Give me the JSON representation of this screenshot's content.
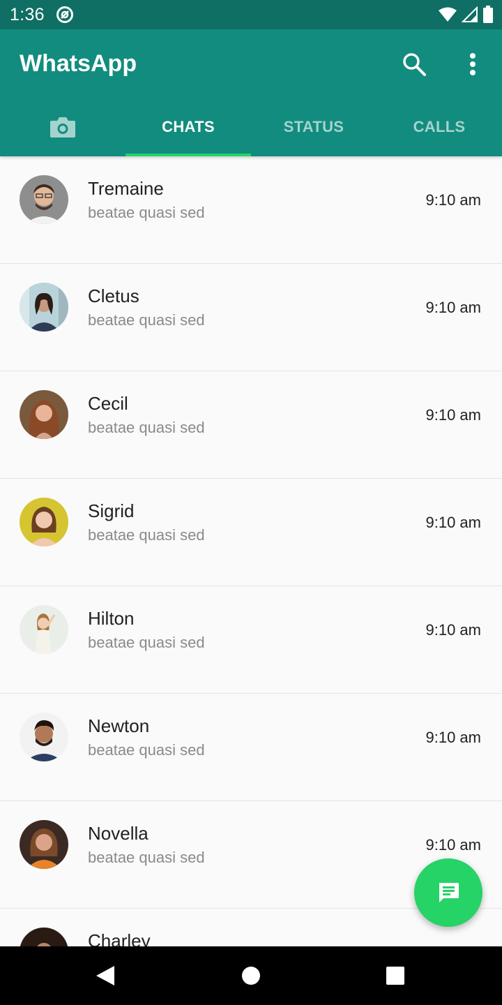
{
  "status_bar": {
    "time": "1:36"
  },
  "app": {
    "title": "WhatsApp"
  },
  "tabs": [
    {
      "label": "CHATS",
      "selected": true
    },
    {
      "label": "STATUS",
      "selected": false
    },
    {
      "label": "CALLS",
      "selected": false
    }
  ],
  "chats": [
    {
      "name": "Tremaine",
      "message": "beatae quasi sed",
      "time": "9:10 am"
    },
    {
      "name": "Cletus",
      "message": "beatae quasi sed",
      "time": "9:10 am"
    },
    {
      "name": "Cecil",
      "message": "beatae quasi sed",
      "time": "9:10 am"
    },
    {
      "name": "Sigrid",
      "message": "beatae quasi sed",
      "time": "9:10 am"
    },
    {
      "name": "Hilton",
      "message": "beatae quasi sed",
      "time": "9:10 am"
    },
    {
      "name": "Newton",
      "message": "beatae quasi sed",
      "time": "9:10 am"
    },
    {
      "name": "Novella",
      "message": "beatae quasi sed",
      "time": "9:10 am"
    },
    {
      "name": "Charley",
      "message": "",
      "time": ""
    }
  ],
  "colors": {
    "status_bar": "#0f6f64",
    "app_bar": "#128c7e",
    "accent": "#25d366"
  },
  "icons": {
    "status_bar": [
      "at-sign-icon",
      "wifi-icon",
      "signal-icon",
      "battery-icon"
    ],
    "app_bar": [
      "search-icon",
      "more-vert-icon"
    ],
    "camera_tab": "camera-icon",
    "fab": "new-chat-icon",
    "nav": [
      "back-icon",
      "home-icon",
      "recents-icon"
    ]
  }
}
